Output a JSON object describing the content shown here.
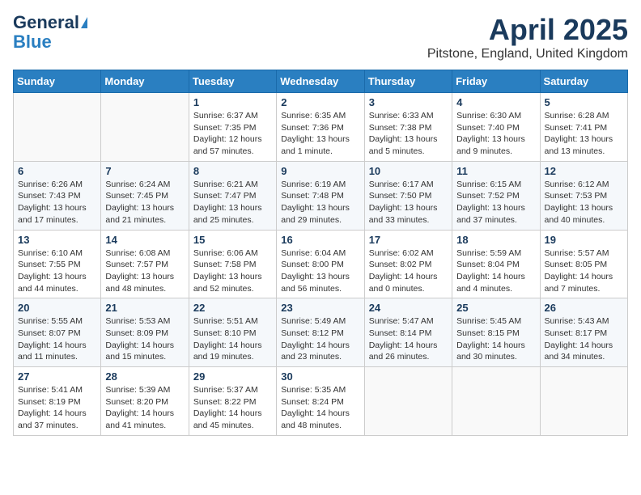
{
  "header": {
    "logo_general": "General",
    "logo_blue": "Blue",
    "title": "April 2025",
    "location": "Pitstone, England, United Kingdom"
  },
  "days_of_week": [
    "Sunday",
    "Monday",
    "Tuesday",
    "Wednesday",
    "Thursday",
    "Friday",
    "Saturday"
  ],
  "weeks": [
    [
      {
        "day": "",
        "info": ""
      },
      {
        "day": "",
        "info": ""
      },
      {
        "day": "1",
        "info": "Sunrise: 6:37 AM\nSunset: 7:35 PM\nDaylight: 12 hours and 57 minutes."
      },
      {
        "day": "2",
        "info": "Sunrise: 6:35 AM\nSunset: 7:36 PM\nDaylight: 13 hours and 1 minute."
      },
      {
        "day": "3",
        "info": "Sunrise: 6:33 AM\nSunset: 7:38 PM\nDaylight: 13 hours and 5 minutes."
      },
      {
        "day": "4",
        "info": "Sunrise: 6:30 AM\nSunset: 7:40 PM\nDaylight: 13 hours and 9 minutes."
      },
      {
        "day": "5",
        "info": "Sunrise: 6:28 AM\nSunset: 7:41 PM\nDaylight: 13 hours and 13 minutes."
      }
    ],
    [
      {
        "day": "6",
        "info": "Sunrise: 6:26 AM\nSunset: 7:43 PM\nDaylight: 13 hours and 17 minutes."
      },
      {
        "day": "7",
        "info": "Sunrise: 6:24 AM\nSunset: 7:45 PM\nDaylight: 13 hours and 21 minutes."
      },
      {
        "day": "8",
        "info": "Sunrise: 6:21 AM\nSunset: 7:47 PM\nDaylight: 13 hours and 25 minutes."
      },
      {
        "day": "9",
        "info": "Sunrise: 6:19 AM\nSunset: 7:48 PM\nDaylight: 13 hours and 29 minutes."
      },
      {
        "day": "10",
        "info": "Sunrise: 6:17 AM\nSunset: 7:50 PM\nDaylight: 13 hours and 33 minutes."
      },
      {
        "day": "11",
        "info": "Sunrise: 6:15 AM\nSunset: 7:52 PM\nDaylight: 13 hours and 37 minutes."
      },
      {
        "day": "12",
        "info": "Sunrise: 6:12 AM\nSunset: 7:53 PM\nDaylight: 13 hours and 40 minutes."
      }
    ],
    [
      {
        "day": "13",
        "info": "Sunrise: 6:10 AM\nSunset: 7:55 PM\nDaylight: 13 hours and 44 minutes."
      },
      {
        "day": "14",
        "info": "Sunrise: 6:08 AM\nSunset: 7:57 PM\nDaylight: 13 hours and 48 minutes."
      },
      {
        "day": "15",
        "info": "Sunrise: 6:06 AM\nSunset: 7:58 PM\nDaylight: 13 hours and 52 minutes."
      },
      {
        "day": "16",
        "info": "Sunrise: 6:04 AM\nSunset: 8:00 PM\nDaylight: 13 hours and 56 minutes."
      },
      {
        "day": "17",
        "info": "Sunrise: 6:02 AM\nSunset: 8:02 PM\nDaylight: 14 hours and 0 minutes."
      },
      {
        "day": "18",
        "info": "Sunrise: 5:59 AM\nSunset: 8:04 PM\nDaylight: 14 hours and 4 minutes."
      },
      {
        "day": "19",
        "info": "Sunrise: 5:57 AM\nSunset: 8:05 PM\nDaylight: 14 hours and 7 minutes."
      }
    ],
    [
      {
        "day": "20",
        "info": "Sunrise: 5:55 AM\nSunset: 8:07 PM\nDaylight: 14 hours and 11 minutes."
      },
      {
        "day": "21",
        "info": "Sunrise: 5:53 AM\nSunset: 8:09 PM\nDaylight: 14 hours and 15 minutes."
      },
      {
        "day": "22",
        "info": "Sunrise: 5:51 AM\nSunset: 8:10 PM\nDaylight: 14 hours and 19 minutes."
      },
      {
        "day": "23",
        "info": "Sunrise: 5:49 AM\nSunset: 8:12 PM\nDaylight: 14 hours and 23 minutes."
      },
      {
        "day": "24",
        "info": "Sunrise: 5:47 AM\nSunset: 8:14 PM\nDaylight: 14 hours and 26 minutes."
      },
      {
        "day": "25",
        "info": "Sunrise: 5:45 AM\nSunset: 8:15 PM\nDaylight: 14 hours and 30 minutes."
      },
      {
        "day": "26",
        "info": "Sunrise: 5:43 AM\nSunset: 8:17 PM\nDaylight: 14 hours and 34 minutes."
      }
    ],
    [
      {
        "day": "27",
        "info": "Sunrise: 5:41 AM\nSunset: 8:19 PM\nDaylight: 14 hours and 37 minutes."
      },
      {
        "day": "28",
        "info": "Sunrise: 5:39 AM\nSunset: 8:20 PM\nDaylight: 14 hours and 41 minutes."
      },
      {
        "day": "29",
        "info": "Sunrise: 5:37 AM\nSunset: 8:22 PM\nDaylight: 14 hours and 45 minutes."
      },
      {
        "day": "30",
        "info": "Sunrise: 5:35 AM\nSunset: 8:24 PM\nDaylight: 14 hours and 48 minutes."
      },
      {
        "day": "",
        "info": ""
      },
      {
        "day": "",
        "info": ""
      },
      {
        "day": "",
        "info": ""
      }
    ]
  ]
}
